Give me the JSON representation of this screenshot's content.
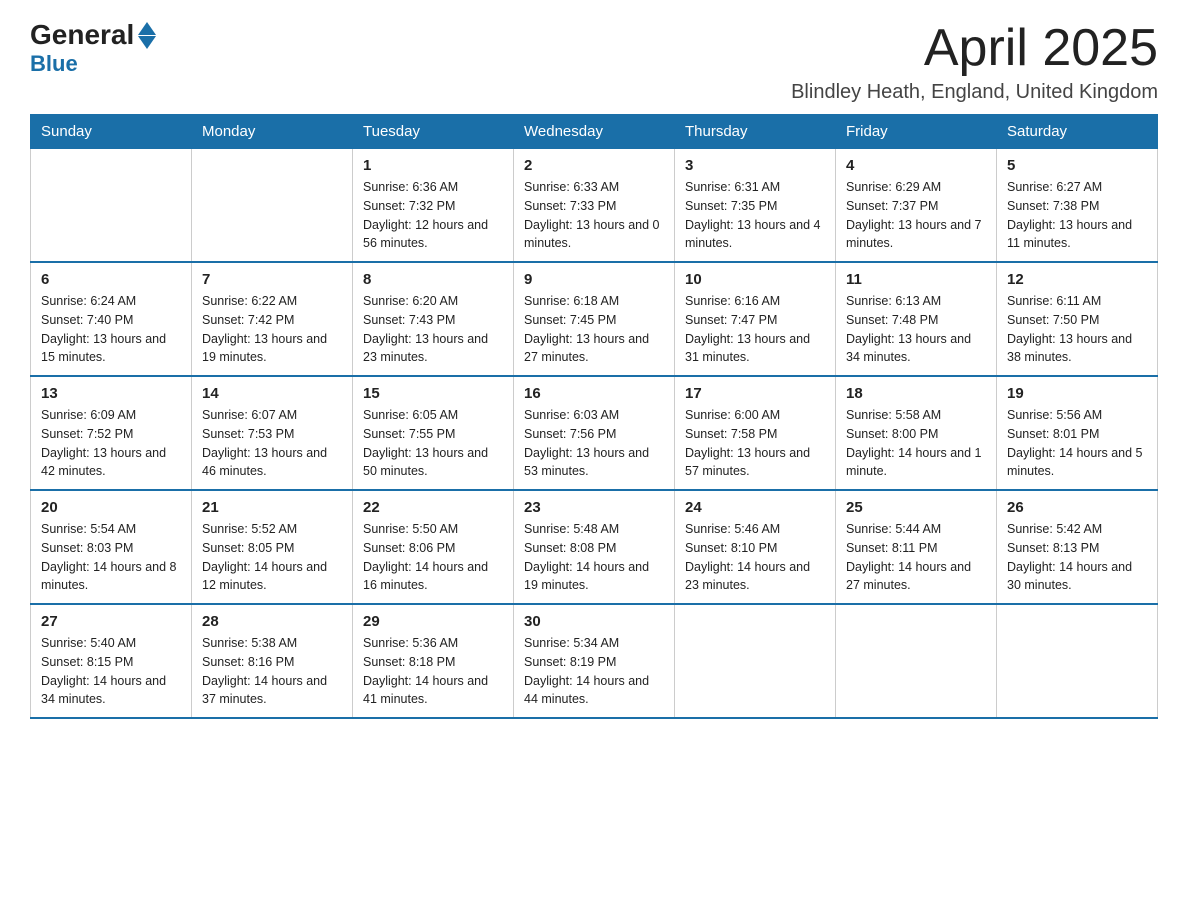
{
  "logo": {
    "text_general": "General",
    "text_blue": "Blue",
    "arrow": true
  },
  "header": {
    "month_title": "April 2025",
    "location": "Blindley Heath, England, United Kingdom"
  },
  "days_of_week": [
    "Sunday",
    "Monday",
    "Tuesday",
    "Wednesday",
    "Thursday",
    "Friday",
    "Saturday"
  ],
  "weeks": [
    [
      {
        "day": "",
        "sunrise": "",
        "sunset": "",
        "daylight": ""
      },
      {
        "day": "",
        "sunrise": "",
        "sunset": "",
        "daylight": ""
      },
      {
        "day": "1",
        "sunrise": "Sunrise: 6:36 AM",
        "sunset": "Sunset: 7:32 PM",
        "daylight": "Daylight: 12 hours and 56 minutes."
      },
      {
        "day": "2",
        "sunrise": "Sunrise: 6:33 AM",
        "sunset": "Sunset: 7:33 PM",
        "daylight": "Daylight: 13 hours and 0 minutes."
      },
      {
        "day": "3",
        "sunrise": "Sunrise: 6:31 AM",
        "sunset": "Sunset: 7:35 PM",
        "daylight": "Daylight: 13 hours and 4 minutes."
      },
      {
        "day": "4",
        "sunrise": "Sunrise: 6:29 AM",
        "sunset": "Sunset: 7:37 PM",
        "daylight": "Daylight: 13 hours and 7 minutes."
      },
      {
        "day": "5",
        "sunrise": "Sunrise: 6:27 AM",
        "sunset": "Sunset: 7:38 PM",
        "daylight": "Daylight: 13 hours and 11 minutes."
      }
    ],
    [
      {
        "day": "6",
        "sunrise": "Sunrise: 6:24 AM",
        "sunset": "Sunset: 7:40 PM",
        "daylight": "Daylight: 13 hours and 15 minutes."
      },
      {
        "day": "7",
        "sunrise": "Sunrise: 6:22 AM",
        "sunset": "Sunset: 7:42 PM",
        "daylight": "Daylight: 13 hours and 19 minutes."
      },
      {
        "day": "8",
        "sunrise": "Sunrise: 6:20 AM",
        "sunset": "Sunset: 7:43 PM",
        "daylight": "Daylight: 13 hours and 23 minutes."
      },
      {
        "day": "9",
        "sunrise": "Sunrise: 6:18 AM",
        "sunset": "Sunset: 7:45 PM",
        "daylight": "Daylight: 13 hours and 27 minutes."
      },
      {
        "day": "10",
        "sunrise": "Sunrise: 6:16 AM",
        "sunset": "Sunset: 7:47 PM",
        "daylight": "Daylight: 13 hours and 31 minutes."
      },
      {
        "day": "11",
        "sunrise": "Sunrise: 6:13 AM",
        "sunset": "Sunset: 7:48 PM",
        "daylight": "Daylight: 13 hours and 34 minutes."
      },
      {
        "day": "12",
        "sunrise": "Sunrise: 6:11 AM",
        "sunset": "Sunset: 7:50 PM",
        "daylight": "Daylight: 13 hours and 38 minutes."
      }
    ],
    [
      {
        "day": "13",
        "sunrise": "Sunrise: 6:09 AM",
        "sunset": "Sunset: 7:52 PM",
        "daylight": "Daylight: 13 hours and 42 minutes."
      },
      {
        "day": "14",
        "sunrise": "Sunrise: 6:07 AM",
        "sunset": "Sunset: 7:53 PM",
        "daylight": "Daylight: 13 hours and 46 minutes."
      },
      {
        "day": "15",
        "sunrise": "Sunrise: 6:05 AM",
        "sunset": "Sunset: 7:55 PM",
        "daylight": "Daylight: 13 hours and 50 minutes."
      },
      {
        "day": "16",
        "sunrise": "Sunrise: 6:03 AM",
        "sunset": "Sunset: 7:56 PM",
        "daylight": "Daylight: 13 hours and 53 minutes."
      },
      {
        "day": "17",
        "sunrise": "Sunrise: 6:00 AM",
        "sunset": "Sunset: 7:58 PM",
        "daylight": "Daylight: 13 hours and 57 minutes."
      },
      {
        "day": "18",
        "sunrise": "Sunrise: 5:58 AM",
        "sunset": "Sunset: 8:00 PM",
        "daylight": "Daylight: 14 hours and 1 minute."
      },
      {
        "day": "19",
        "sunrise": "Sunrise: 5:56 AM",
        "sunset": "Sunset: 8:01 PM",
        "daylight": "Daylight: 14 hours and 5 minutes."
      }
    ],
    [
      {
        "day": "20",
        "sunrise": "Sunrise: 5:54 AM",
        "sunset": "Sunset: 8:03 PM",
        "daylight": "Daylight: 14 hours and 8 minutes."
      },
      {
        "day": "21",
        "sunrise": "Sunrise: 5:52 AM",
        "sunset": "Sunset: 8:05 PM",
        "daylight": "Daylight: 14 hours and 12 minutes."
      },
      {
        "day": "22",
        "sunrise": "Sunrise: 5:50 AM",
        "sunset": "Sunset: 8:06 PM",
        "daylight": "Daylight: 14 hours and 16 minutes."
      },
      {
        "day": "23",
        "sunrise": "Sunrise: 5:48 AM",
        "sunset": "Sunset: 8:08 PM",
        "daylight": "Daylight: 14 hours and 19 minutes."
      },
      {
        "day": "24",
        "sunrise": "Sunrise: 5:46 AM",
        "sunset": "Sunset: 8:10 PM",
        "daylight": "Daylight: 14 hours and 23 minutes."
      },
      {
        "day": "25",
        "sunrise": "Sunrise: 5:44 AM",
        "sunset": "Sunset: 8:11 PM",
        "daylight": "Daylight: 14 hours and 27 minutes."
      },
      {
        "day": "26",
        "sunrise": "Sunrise: 5:42 AM",
        "sunset": "Sunset: 8:13 PM",
        "daylight": "Daylight: 14 hours and 30 minutes."
      }
    ],
    [
      {
        "day": "27",
        "sunrise": "Sunrise: 5:40 AM",
        "sunset": "Sunset: 8:15 PM",
        "daylight": "Daylight: 14 hours and 34 minutes."
      },
      {
        "day": "28",
        "sunrise": "Sunrise: 5:38 AM",
        "sunset": "Sunset: 8:16 PM",
        "daylight": "Daylight: 14 hours and 37 minutes."
      },
      {
        "day": "29",
        "sunrise": "Sunrise: 5:36 AM",
        "sunset": "Sunset: 8:18 PM",
        "daylight": "Daylight: 14 hours and 41 minutes."
      },
      {
        "day": "30",
        "sunrise": "Sunrise: 5:34 AM",
        "sunset": "Sunset: 8:19 PM",
        "daylight": "Daylight: 14 hours and 44 minutes."
      },
      {
        "day": "",
        "sunrise": "",
        "sunset": "",
        "daylight": ""
      },
      {
        "day": "",
        "sunrise": "",
        "sunset": "",
        "daylight": ""
      },
      {
        "day": "",
        "sunrise": "",
        "sunset": "",
        "daylight": ""
      }
    ]
  ]
}
